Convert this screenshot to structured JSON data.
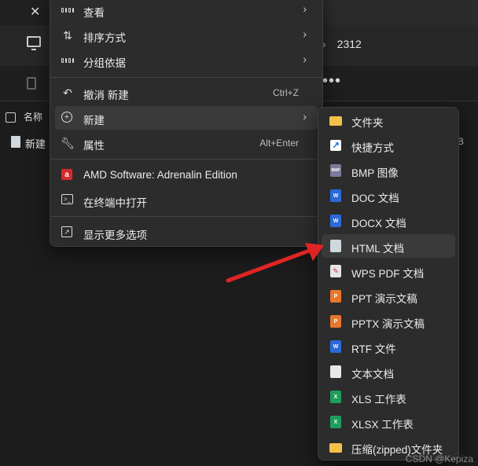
{
  "explorer": {
    "tab_close": "✕",
    "path_separator": "›",
    "path_current": "2312",
    "more_button": "•••",
    "column_name": "名称",
    "file_name": "新建",
    "file_size_partial": "B"
  },
  "main_menu": {
    "items": [
      {
        "label": "查看",
        "icon": "view-grid-icon",
        "has_submenu": true
      },
      {
        "label": "排序方式",
        "icon": "sort-icon",
        "has_submenu": true
      },
      {
        "label": "分组依据",
        "icon": "group-icon",
        "has_submenu": true
      },
      {
        "label": "撤消 新建",
        "icon": "undo-icon",
        "shortcut": "Ctrl+Z"
      },
      {
        "label": "新建",
        "icon": "new-plus-icon",
        "has_submenu": true,
        "highlighted": true
      },
      {
        "label": "属性",
        "icon": "properties-wrench-icon",
        "shortcut": "Alt+Enter"
      },
      {
        "label": "AMD Software: Adrenalin Edition",
        "icon": "amd-icon"
      },
      {
        "label": "在终端中打开",
        "icon": "terminal-icon"
      },
      {
        "label": "显示更多选项",
        "icon": "more-options-icon"
      }
    ],
    "submenu_arrow": "›"
  },
  "sub_menu": {
    "items": [
      {
        "label": "文件夹",
        "icon": "folder-icon"
      },
      {
        "label": "快捷方式",
        "icon": "shortcut-icon"
      },
      {
        "label": "BMP 图像",
        "icon": "bmp-icon"
      },
      {
        "label": "DOC 文档",
        "icon": "doc-icon"
      },
      {
        "label": "DOCX 文档",
        "icon": "docx-icon"
      },
      {
        "label": "HTML 文档",
        "icon": "html-icon",
        "highlighted": true
      },
      {
        "label": "WPS PDF 文档",
        "icon": "pdf-icon"
      },
      {
        "label": "PPT 演示文稿",
        "icon": "ppt-icon"
      },
      {
        "label": "PPTX 演示文稿",
        "icon": "pptx-icon"
      },
      {
        "label": "RTF 文件",
        "icon": "rtf-icon"
      },
      {
        "label": "文本文档",
        "icon": "txt-icon"
      },
      {
        "label": "XLS 工作表",
        "icon": "xls-icon"
      },
      {
        "label": "XLSX 工作表",
        "icon": "xlsx-icon"
      },
      {
        "label": "压缩(zipped)文件夹",
        "icon": "zip-folder-icon"
      }
    ]
  },
  "annotation": {
    "arrow_color": "#e02424"
  },
  "watermark": "CSDN @Kepiza"
}
